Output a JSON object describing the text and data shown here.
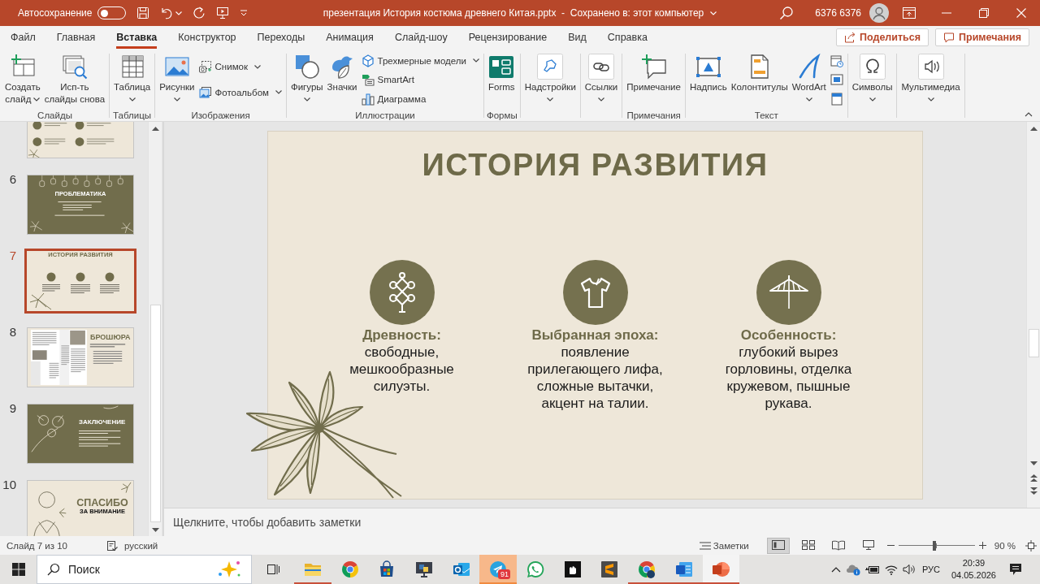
{
  "title_bar": {
    "autosave_label": "Автосохранение",
    "autosave": false,
    "document_title": "презентация История костюма древнего Китая.pptx  -  Сохранено в: этот компьютер",
    "user_name": "6376 6376"
  },
  "ribbon_tabs": [
    {
      "label": "Файл",
      "selected": false
    },
    {
      "label": "Главная",
      "selected": false
    },
    {
      "label": "Вставка",
      "selected": true
    },
    {
      "label": "Конструктор",
      "selected": false
    },
    {
      "label": "Переходы",
      "selected": false
    },
    {
      "label": "Анимация",
      "selected": false
    },
    {
      "label": "Слайд-шоу",
      "selected": false
    },
    {
      "label": "Рецензирование",
      "selected": false
    },
    {
      "label": "Вид",
      "selected": false
    },
    {
      "label": "Справка",
      "selected": false
    }
  ],
  "ribbon_buttons": [
    {
      "label": "Поделиться"
    },
    {
      "label": "Примечания"
    }
  ],
  "ribbon_groups": [
    {
      "label": "Слайды",
      "commands": [
        {
          "kind": "large",
          "label": "Создать\nслайд",
          "dropdown": true
        },
        {
          "kind": "large",
          "label": "Исп-ть\nслайды снова",
          "dropdown": false
        }
      ]
    },
    {
      "label": "Таблицы",
      "commands": [
        {
          "kind": "large",
          "label": "Таблица",
          "dropdown": true
        }
      ]
    },
    {
      "label": "Изображения",
      "commands": [
        {
          "kind": "large",
          "label": "Рисунки",
          "dropdown": true
        },
        {
          "kind": "small",
          "label": "Снимок",
          "dropdown": true
        },
        {
          "kind": "small",
          "label": "Фотоальбом",
          "dropdown": true
        }
      ]
    },
    {
      "label": "Иллюстрации",
      "commands": [
        {
          "kind": "large",
          "label": "Фигуры",
          "dropdown": true
        },
        {
          "kind": "large",
          "label": "Значки",
          "dropdown": false
        },
        {
          "kind": "small",
          "label": "Трехмерные модели",
          "dropdown": true
        },
        {
          "kind": "small",
          "label": "SmartArt",
          "dropdown": false
        },
        {
          "kind": "small",
          "label": "Диаграмма",
          "dropdown": false
        }
      ]
    },
    {
      "label": "Формы",
      "commands": [
        {
          "kind": "large",
          "label": "Forms",
          "dropdown": false
        }
      ]
    },
    {
      "commands": [
        {
          "kind": "large",
          "label": "Надстройки",
          "dropdown": true
        }
      ]
    },
    {
      "commands": [
        {
          "kind": "large",
          "label": "Ссылки",
          "dropdown": true
        }
      ]
    },
    {
      "label": "Примечания",
      "commands": [
        {
          "kind": "large",
          "label": "Примечание",
          "dropdown": false
        }
      ]
    },
    {
      "label": "Текст",
      "commands": [
        {
          "kind": "large",
          "label": "Надпись",
          "dropdown": false
        },
        {
          "kind": "large",
          "label": "Колонтитулы",
          "dropdown": false
        },
        {
          "kind": "large",
          "label": "WordArt",
          "dropdown": true
        },
        {
          "kind": "icon"
        },
        {
          "kind": "icon"
        },
        {
          "kind": "icon"
        }
      ]
    },
    {
      "commands": [
        {
          "kind": "large",
          "label": "Символы",
          "dropdown": true
        }
      ]
    },
    {
      "commands": [
        {
          "kind": "large",
          "label": "Мультимедиа",
          "dropdown": true
        }
      ]
    }
  ],
  "slide_thumbnails": [
    {
      "kind": "icon-grid",
      "selected": false
    },
    {
      "number": "6",
      "kind": "problem",
      "title": "ПРОБЛЕМАТИКА",
      "selected": false
    },
    {
      "number": "7",
      "kind": "history",
      "title": "ИСТОРИЯ РАЗВИТИЯ",
      "selected": true
    },
    {
      "number": "8",
      "kind": "brochure",
      "title": "БРОШЮРА",
      "selected": false
    },
    {
      "number": "9",
      "kind": "conclusion",
      "title": "ЗАКЛЮЧЕНИЕ",
      "selected": false
    },
    {
      "number": "10",
      "kind": "thanks",
      "title": "СПАСИБО",
      "subtitle": "ЗА ВНИМАНИЕ",
      "selected": false
    }
  ],
  "slide": {
    "title": "ИСТОРИЯ РАЗВИТИЯ",
    "items": [
      {
        "heading": "Древность:",
        "text": "свободные,\nмешкообразные\nсилуэты."
      },
      {
        "heading": "Выбранная эпоха:",
        "text": "появление\nприлегающего лифа,\nсложные вытачки,\nакцент на талии."
      },
      {
        "heading": "Особенность:",
        "text": "глубокий вырез\nгорловины, отделка\nкружевом, пышные\nрукава."
      }
    ]
  },
  "notes": {
    "placeholder": "Щелкните, чтобы добавить заметки"
  },
  "status_bar": {
    "slide_info": "Слайд 7 из 10",
    "language": "русский",
    "notes_button": "Заметки",
    "views": [
      {
        "selected": true
      },
      {
        "selected": false
      },
      {
        "selected": false
      },
      {
        "selected": false
      }
    ],
    "zoom": {
      "level": 0.47,
      "reading": "90 %"
    }
  },
  "taskbar": {
    "search": {
      "placeholder": "Поиск"
    },
    "apps": [
      {
        "running": true,
        "active": false,
        "attention": false
      },
      {
        "running": false,
        "active": false,
        "attention": false
      },
      {
        "running": false,
        "active": false,
        "attention": false
      },
      {
        "running": false,
        "active": false,
        "attention": false
      },
      {
        "running": false,
        "active": false,
        "attention": false
      },
      {
        "running": true,
        "active": false,
        "attention": true,
        "badge": "91"
      },
      {
        "running": false,
        "active": false,
        "attention": false
      },
      {
        "running": false,
        "active": false,
        "attention": false
      },
      {
        "running": false,
        "active": false,
        "attention": false
      },
      {
        "running": true,
        "active": false,
        "attention": false
      },
      {
        "running": true,
        "active": false,
        "attention": false
      },
      {
        "running": true,
        "active": true,
        "attention": false
      }
    ],
    "tray": {
      "language": "РУС",
      "time": "20:39",
      "date": "04.05.2026"
    }
  }
}
